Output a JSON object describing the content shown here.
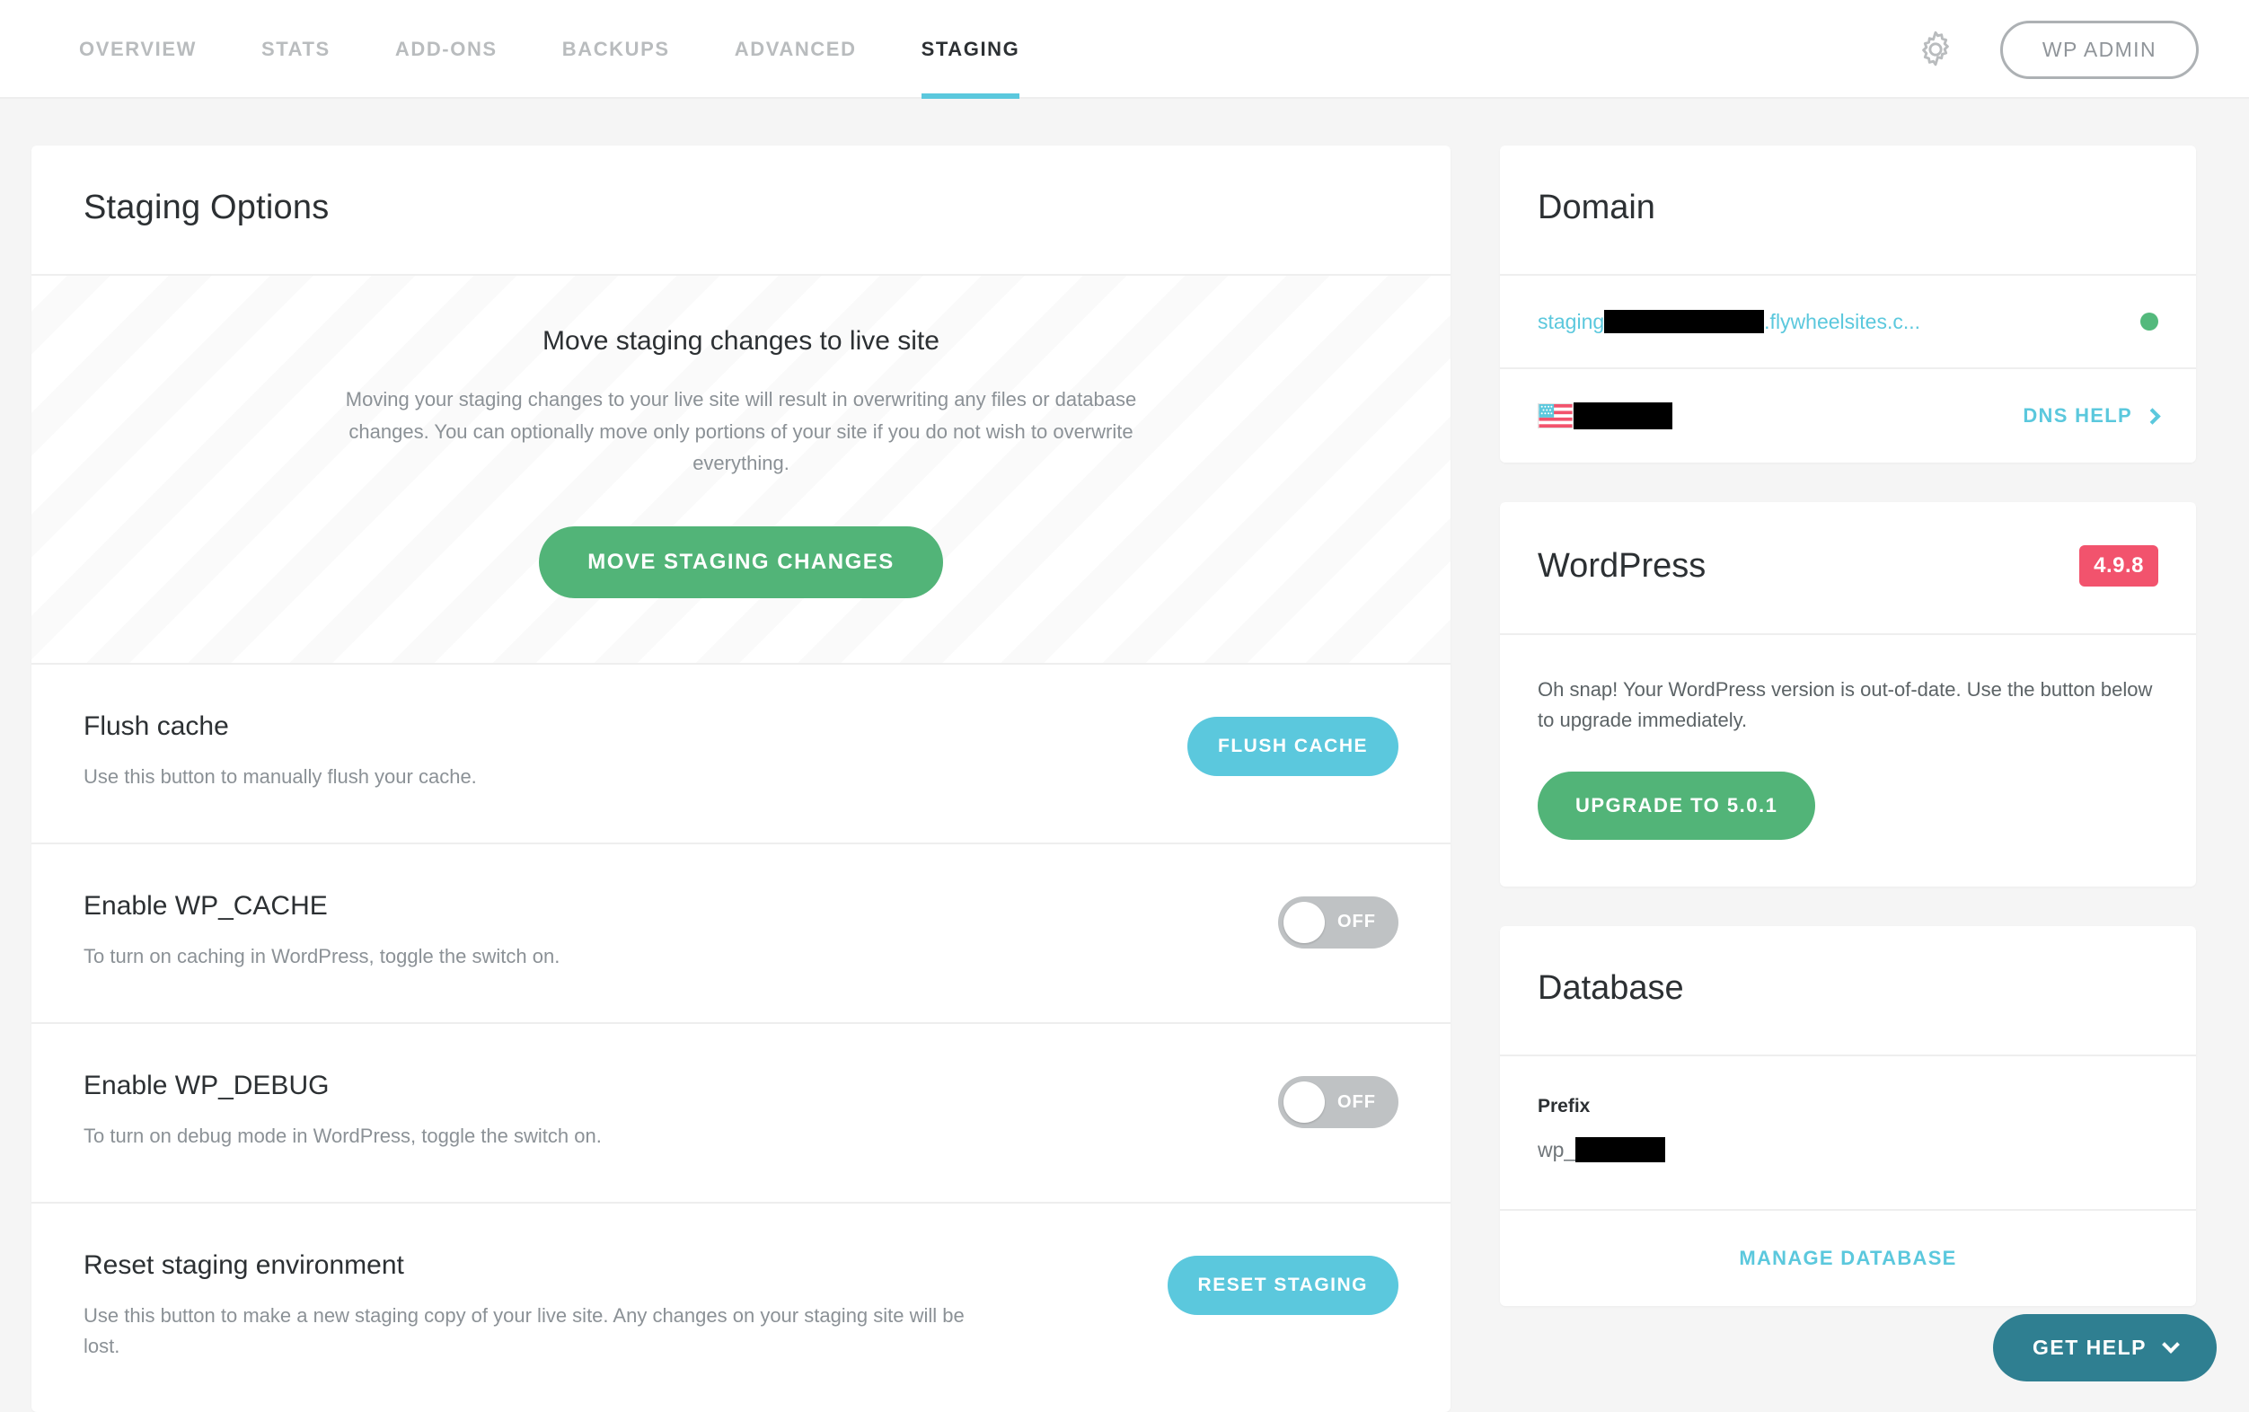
{
  "nav": {
    "tabs": [
      {
        "label": "OVERVIEW",
        "active": false
      },
      {
        "label": "STATS",
        "active": false
      },
      {
        "label": "ADD-ONS",
        "active": false
      },
      {
        "label": "BACKUPS",
        "active": false
      },
      {
        "label": "ADVANCED",
        "active": false
      },
      {
        "label": "STAGING",
        "active": true
      }
    ],
    "gear_icon": "gear-icon",
    "wp_admin_label": "WP ADMIN"
  },
  "staging": {
    "title": "Staging Options",
    "banner": {
      "heading": "Move staging changes to live site",
      "body": "Moving your staging changes to your live site will result in overwriting any files or database changes. You can optionally move only portions of your site if you do not wish to overwrite everything.",
      "button_label": "MOVE STAGING CHANGES"
    },
    "options": [
      {
        "title": "Flush cache",
        "desc": "Use this button to manually flush your cache.",
        "control": "button",
        "button_label": "FLUSH CACHE"
      },
      {
        "title": "Enable WP_CACHE",
        "desc": "To turn on caching in WordPress, toggle the switch on.",
        "control": "toggle",
        "toggle_label": "OFF",
        "toggle_state": "off"
      },
      {
        "title": "Enable WP_DEBUG",
        "desc": "To turn on debug mode in WordPress, toggle the switch on.",
        "control": "toggle",
        "toggle_label": "OFF",
        "toggle_state": "off"
      },
      {
        "title": "Reset staging environment",
        "desc": "Use this button to make a new staging copy of your live site. Any changes on your staging site will be lost.",
        "control": "button",
        "button_label": "RESET STAGING"
      }
    ]
  },
  "domain": {
    "title": "Domain",
    "url_prefix": "staging",
    "url_suffix": ".flywheelsites.c...",
    "url_redacted": true,
    "status": "online",
    "status_color": "#53b97c",
    "flag_icon": "us-flag-icon",
    "region_redacted": true,
    "dns_help_label": "DNS HELP"
  },
  "wordpress": {
    "title": "WordPress",
    "version_badge": "4.9.8",
    "badge_color": "#f2536d",
    "note": "Oh snap! Your WordPress version is out-of-date. Use the button below to upgrade immediately.",
    "upgrade_label": "UPGRADE TO 5.0.1"
  },
  "database": {
    "title": "Database",
    "prefix_label": "Prefix",
    "prefix_value": "wp_",
    "prefix_redacted": true,
    "manage_label": "MANAGE DATABASE"
  },
  "support": {
    "get_help_label": "GET HELP",
    "chevron_icon": "chevron-down-icon",
    "color": "#2f7f91"
  }
}
